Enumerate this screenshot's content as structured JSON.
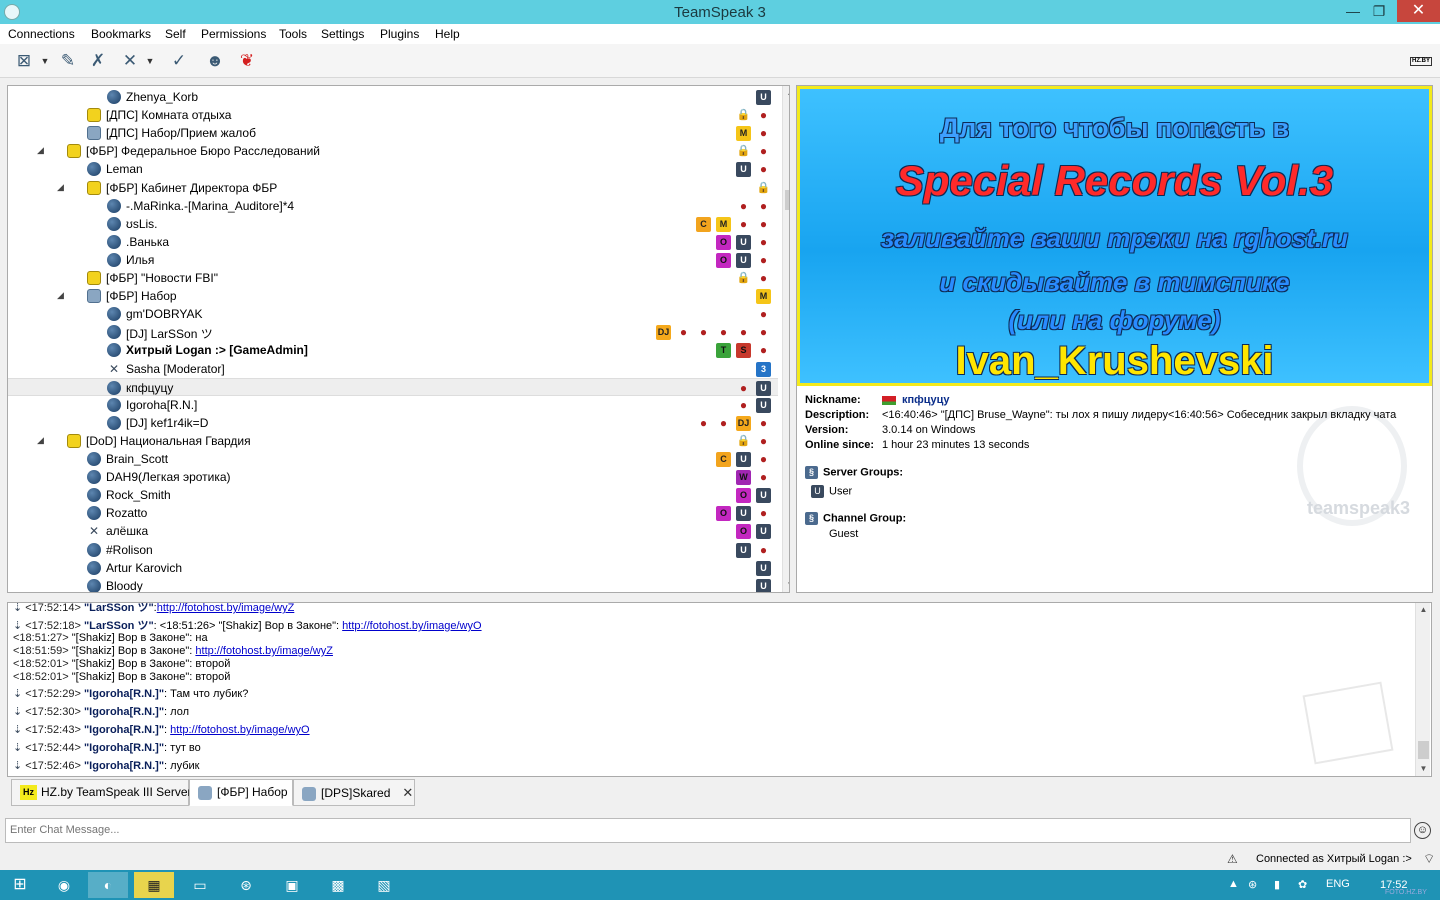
{
  "window": {
    "title": "TeamSpeak 3",
    "min": "—",
    "max": "❐",
    "close": "✕"
  },
  "menu": [
    "Connections",
    "Bookmarks",
    "Self",
    "Permissions",
    "Tools",
    "Settings",
    "Plugins",
    "Help"
  ],
  "toolbar": {
    "hz_label": "HZ.BY"
  },
  "tree": {
    "rows": [
      {
        "name": "Zhenya_Korb",
        "type": "client",
        "indent": 1,
        "badges": [
          "U"
        ]
      },
      {
        "name": "[ДПС] Комната отдыха",
        "type": "channel",
        "indent": 0,
        "badges": [
          "lock",
          "misc"
        ]
      },
      {
        "name": "[ДПС] Набор/Прием жалоб",
        "type": "channel-grey",
        "indent": 0,
        "badges": [
          "M",
          "misc"
        ]
      },
      {
        "name": "[ФБР] Федеральное Бюро Расследований",
        "type": "channel",
        "indent": -1,
        "arrow": "◢",
        "badges": [
          "lock",
          "misc"
        ]
      },
      {
        "name": "Leman",
        "type": "client",
        "indent": 0,
        "badges": [
          "U",
          "misc"
        ]
      },
      {
        "name": "[ФБР] Кабинет Директора ФБР",
        "type": "channel",
        "indent": 0,
        "arrow": "◢",
        "badges": [
          "lock"
        ]
      },
      {
        "name": "-.MaRinka.-[Marina_Auditore]*4",
        "type": "client",
        "indent": 1,
        "badges": [
          "misc",
          "misc"
        ]
      },
      {
        "name": "ʊsLis.",
        "type": "client",
        "indent": 1,
        "badges": [
          "C",
          "M",
          "misc",
          "misc"
        ]
      },
      {
        "name": ".Ванька",
        "type": "client",
        "indent": 1,
        "badges": [
          "O",
          "U",
          "misc"
        ]
      },
      {
        "name": "Илья",
        "type": "client",
        "indent": 1,
        "badges": [
          "O",
          "U",
          "misc"
        ]
      },
      {
        "name": "[ФБР] \"Новости FBI\"",
        "type": "channel",
        "indent": 0,
        "badges": [
          "lock",
          "misc"
        ]
      },
      {
        "name": "[ФБР] Набор",
        "type": "channel-grey",
        "indent": 0,
        "arrow": "◢",
        "badges": [
          "M"
        ]
      },
      {
        "name": "gm'DOBRYAK",
        "type": "client",
        "indent": 1,
        "badges": [
          "misc"
        ]
      },
      {
        "name": "[DJ] LarSSon ツ",
        "type": "client",
        "indent": 1,
        "badges": [
          "DJ",
          "misc",
          "misc",
          "misc",
          "misc",
          "misc"
        ]
      },
      {
        "name": "Хитрый Logan :> [GameAdmin]",
        "type": "client",
        "indent": 1,
        "bold": true,
        "badges": [
          "T",
          "S",
          "misc"
        ]
      },
      {
        "name": "Sasha [Moderator]",
        "type": "muted",
        "indent": 1,
        "badges": [
          "3"
        ]
      },
      {
        "name": "кпфцуцу",
        "type": "client",
        "indent": 1,
        "selected": true,
        "badges": [
          "misc",
          "U"
        ]
      },
      {
        "name": "Igoroha[R.N.]",
        "type": "client",
        "indent": 1,
        "badges": [
          "misc",
          "U"
        ]
      },
      {
        "name": "[DJ] kef1r4ik=D",
        "type": "client",
        "indent": 1,
        "badges": [
          "misc",
          "misc",
          "DJ",
          "misc"
        ]
      },
      {
        "name": "[DoD] Национальная Гвардия",
        "type": "channel",
        "indent": -1,
        "arrow": "◢",
        "badges": [
          "lock",
          "misc"
        ]
      },
      {
        "name": "Brain_Scott",
        "type": "client",
        "indent": 0,
        "badges": [
          "C",
          "U",
          "misc"
        ]
      },
      {
        "name": "DAH9(Легкая эротика)",
        "type": "client",
        "indent": 0,
        "badges": [
          "W",
          "misc"
        ]
      },
      {
        "name": "Rock_Smith",
        "type": "client",
        "indent": 0,
        "badges": [
          "O",
          "U"
        ]
      },
      {
        "name": "Rozatto",
        "type": "client",
        "indent": 0,
        "badges": [
          "O",
          "U",
          "misc"
        ]
      },
      {
        "name": "алёшка",
        "type": "muted",
        "indent": 0,
        "badges": [
          "O",
          "U"
        ]
      },
      {
        "name": "#Rolison",
        "type": "client",
        "indent": 0,
        "badges": [
          "U",
          "misc"
        ]
      },
      {
        "name": "Artur Karovich",
        "type": "client",
        "indent": 0,
        "badges": [
          "U"
        ]
      },
      {
        "name": "Bloody",
        "type": "client",
        "indent": 0,
        "badges": [
          "U"
        ]
      }
    ]
  },
  "banner": {
    "line1": "Для того чтобы попасть в",
    "line2": "Special Records Vol.3",
    "line3": "заливайте ваши трэки на rghost.ru",
    "line4": "и скидывайте  в тимспике",
    "line5": "(или на форуме)",
    "line6": "Ivan_Krushevski"
  },
  "client_info": {
    "nickname_label": "Nickname:",
    "nickname": "кпфцуцу",
    "description_label": "Description:",
    "description": "<16:40:46> \"[ДПС] Bruse_Wayne\": ты лох я пишу лидеру<16:40:56> Собеседник закрыл вкладку чата",
    "version_label": "Version:",
    "version": "3.0.14 on Windows",
    "online_label": "Online since:",
    "online": "1 hour 23 minutes 13 seconds",
    "server_groups_label": "Server Groups:",
    "server_group": "User",
    "channel_group_label": "Channel Group:",
    "channel_group": "Guest",
    "logo_text": "teamspeak3"
  },
  "chat": {
    "lines": [
      {
        "arrow": true,
        "time": "<17:52:14>",
        "nick": "\"LarSSon ツ\"",
        "text": ":",
        "link": "http://fotohost.by/image/wyZ"
      },
      {
        "arrow": true,
        "time": "<17:52:18>",
        "nick": "\"LarSSon ツ\"",
        "text": ": <18:51:26> \"[Shakiz] Вор в Законе\": ",
        "link": "http://fotohost.by/image/wyO"
      },
      {
        "arrow": false,
        "time": "<18:51:27>",
        "nick": "",
        "text": "\"[Shakiz] Вор в Законе\": на",
        "link": ""
      },
      {
        "arrow": false,
        "time": "<18:51:59>",
        "nick": "",
        "text": "\"[Shakiz] Вор в Законе\": ",
        "link": "http://fotohost.by/image/wyZ"
      },
      {
        "arrow": false,
        "time": "<18:52:01>",
        "nick": "",
        "text": "\"[Shakiz] Вор в Законе\": второй",
        "link": ""
      },
      {
        "arrow": false,
        "time": "<18:52:01>",
        "nick": "",
        "text": "\"[Shakiz] Вор в Законе\": второй",
        "link": ""
      },
      {
        "arrow": true,
        "time": "<17:52:29>",
        "nick": "\"Igoroha[R.N.]\"",
        "text": ": Там что лубик?",
        "link": ""
      },
      {
        "arrow": true,
        "time": "<17:52:30>",
        "nick": "\"Igoroha[R.N.]\"",
        "text": ": лол",
        "link": ""
      },
      {
        "arrow": true,
        "time": "<17:52:43>",
        "nick": "\"Igoroha[R.N.]\"",
        "text": ": ",
        "link": "http://fotohost.by/image/wyO"
      },
      {
        "arrow": true,
        "time": "<17:52:44>",
        "nick": "\"Igoroha[R.N.]\"",
        "text": ": тут во",
        "link": ""
      },
      {
        "arrow": true,
        "time": "<17:52:46>",
        "nick": "\"Igoroha[R.N.]\"",
        "text": ": лубик",
        "link": ""
      }
    ]
  },
  "tabs": [
    {
      "label": "HZ.by TeamSpeak III Server",
      "icon": "Hz",
      "active": false,
      "closable": false
    },
    {
      "label": "[ФБР] Набор",
      "icon": "channel",
      "active": true,
      "closable": false
    },
    {
      "label": "[DPS]Skared",
      "icon": "channel",
      "active": false,
      "closable": true
    }
  ],
  "chat_input": {
    "placeholder": "Enter Chat Message..."
  },
  "status": {
    "connected": "Connected as Хитрый Logan :>"
  },
  "taskbar": {
    "lang": "ENG",
    "time": "17:52",
    "watermark": "FOTO.HZ.BY"
  }
}
